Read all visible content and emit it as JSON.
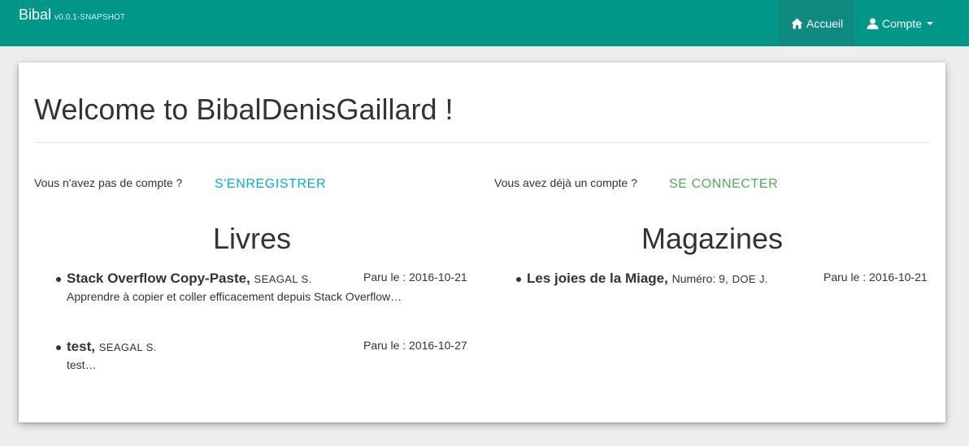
{
  "navbar": {
    "brand": "Bibal",
    "version": "v0.0.1-SNAPSHOT",
    "home_label": "Accueil",
    "home_icon": "home-icon",
    "account_label": "Compte",
    "account_icon": "user-icon"
  },
  "main": {
    "title": "Welcome to BibalDenisGaillard !",
    "register_prompt": "Vous n'avez pas de compte ?",
    "register_link": "S'ENREGISTRER",
    "login_prompt": "Vous avez déjà un compte ?",
    "login_link": "SE CONNECTER"
  },
  "books": {
    "heading": "Livres",
    "items": [
      {
        "title": "Stack Overflow Copy-Paste,",
        "author": "Seagal S.",
        "description": "Apprendre à copier et coller efficacement depuis Stack Overflow…",
        "date": "Paru le : 2016-10-21"
      },
      {
        "title": "test,",
        "author": "Seagal S.",
        "description": "test…",
        "date": "Paru le : 2016-10-27"
      }
    ]
  },
  "magazines": {
    "heading": "Magazines",
    "items": [
      {
        "title": "Les joies de la Miage,",
        "issue": "Numéro: 9,",
        "author": "Doe J.",
        "date": "Paru le : 2016-10-21"
      }
    ]
  },
  "colors": {
    "navbar": "#009688",
    "navbar_active": "#0e8b7e",
    "register_link": "#03a9f4",
    "login_link": "#4caf50"
  }
}
